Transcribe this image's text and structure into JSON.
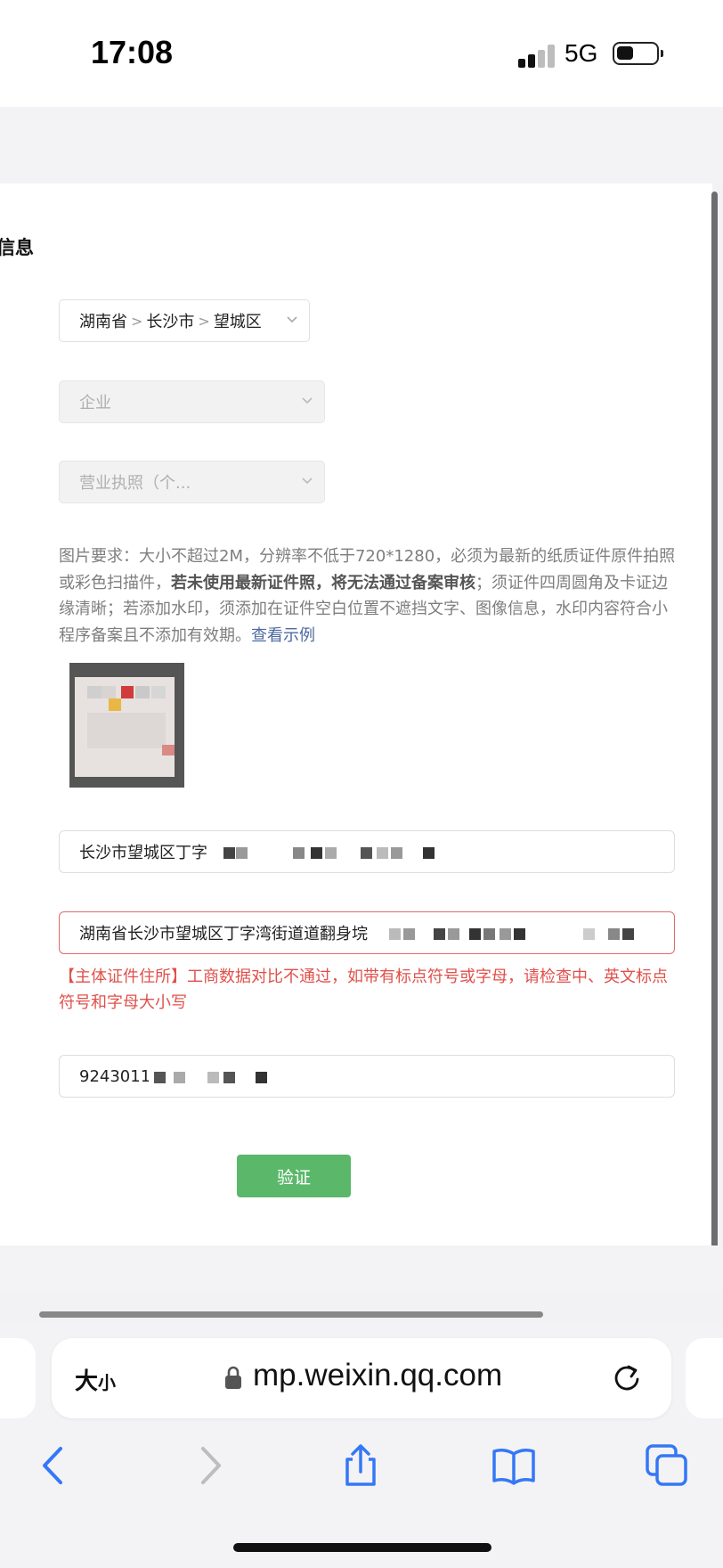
{
  "status_bar": {
    "time": "17:08",
    "network": "5G"
  },
  "form": {
    "section_title": "信息",
    "region": {
      "province": "湖南省",
      "city": "长沙市",
      "district": "望城区"
    },
    "entity_type": {
      "placeholder": "企业"
    },
    "document_type": {
      "placeholder": "营业执照（个..."
    },
    "requirements": {
      "prefix": "图片要求：大小不超过2M，分辨率不低于720*1280，必须为最新的纸质证件原件拍照或彩色扫描件，",
      "bold": "若未使用最新证件照，将无法通过备案审核",
      "suffix": "；须证件四周圆角及卡证边缘清晰；若添加水印，须添加在证件空白位置不遮挡文字、图像信息，水印内容符合小程序备案且不添加有效期。",
      "link": "查看示例"
    },
    "address_1": "长沙市望城区丁字",
    "address_2": "湖南省长沙市望城区丁字湾街道道翻身垸",
    "address_error": "【主体证件住所】工商数据对比不通过，如带有标点符号或字母，请检查中、英文标点符号和字母大小写",
    "credit_code": "92430112",
    "verify_label": "验证"
  },
  "browser": {
    "text_size_label": "大",
    "text_size_small": "小",
    "url": "mp.weixin.qq.com"
  },
  "icons": [
    "lock-icon",
    "reload-icon",
    "back-icon",
    "forward-icon",
    "share-icon",
    "bookmarks-icon",
    "tabs-icon",
    "chevron-down-icon"
  ],
  "colors": {
    "accent_green": "#5bb86b",
    "error_red": "#e0504a",
    "link_blue": "#4c6aa0",
    "ios_blue": "#3478f6"
  }
}
